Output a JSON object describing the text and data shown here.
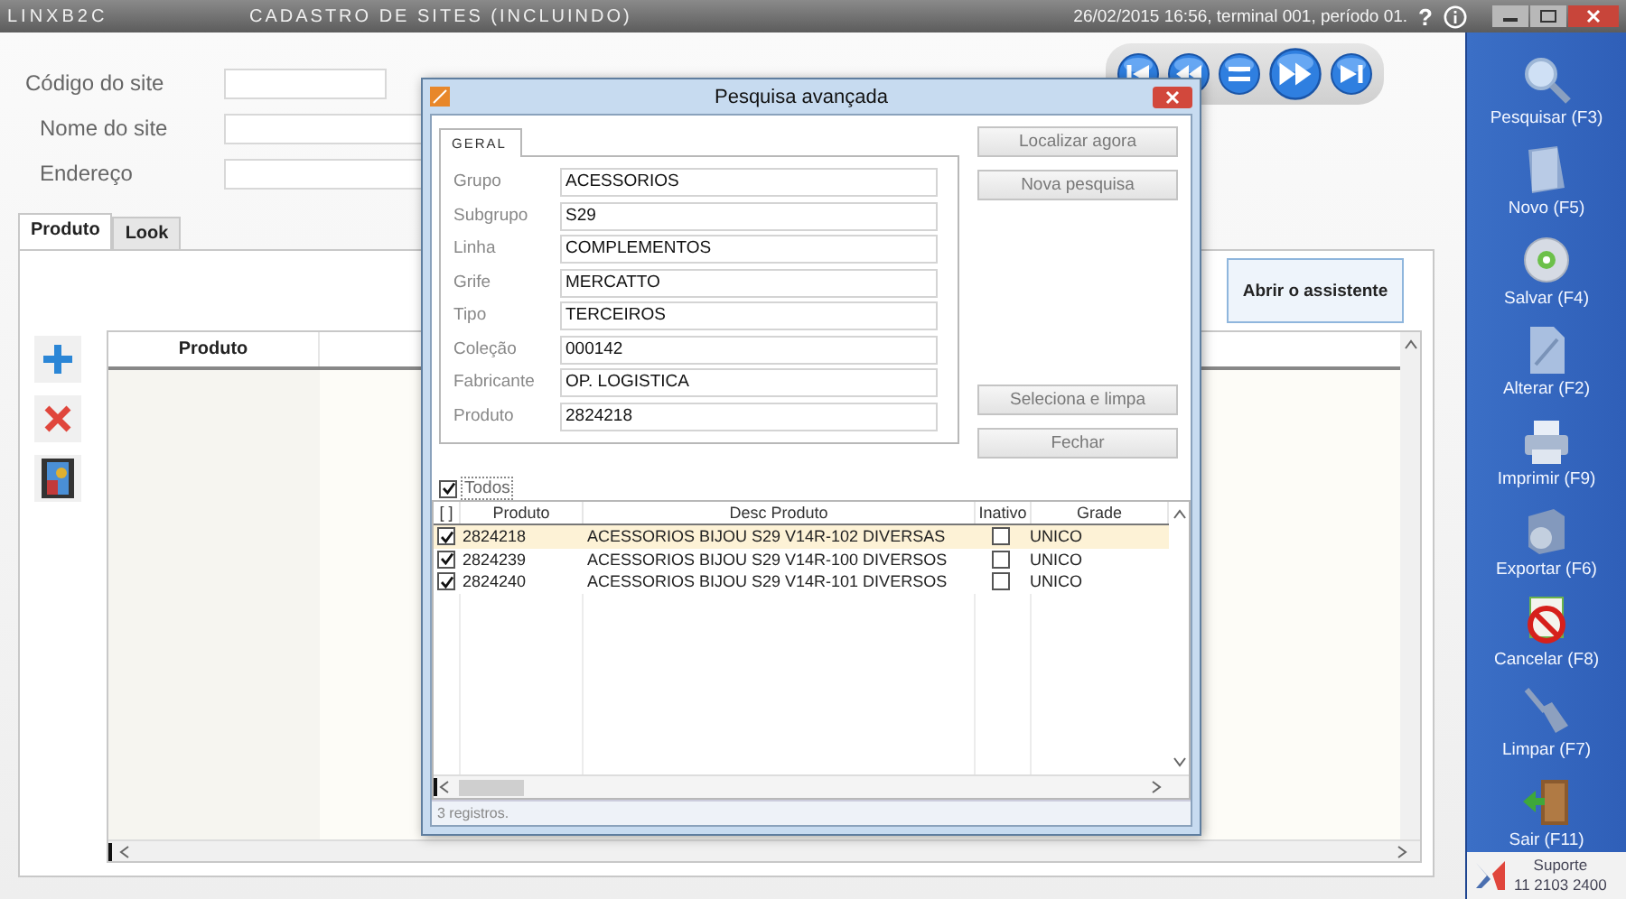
{
  "title_bar": {
    "brand": "LINXB2C",
    "title": "CADASTRO DE SITES (INCLUINDO)",
    "status": "26/02/2015 16:56, terminal 001, período 01.",
    "help": "?"
  },
  "form": {
    "fields": [
      {
        "label": "Código do site"
      },
      {
        "label": "Nome do site"
      },
      {
        "label": "Endereço"
      }
    ]
  },
  "tabs": [
    {
      "label": "Produto",
      "selected": true
    },
    {
      "label": "Look",
      "selected": false
    }
  ],
  "assistant_button": "Abrir o assistente",
  "grid": {
    "columns": [
      "Produto"
    ]
  },
  "dialog": {
    "title": "Pesquisa avançada",
    "tab": {
      "label": "GERAL",
      "selected": true
    },
    "fields": [
      {
        "label": "Grupo",
        "value": "ACESSORIOS"
      },
      {
        "label": "Subgrupo",
        "value": "S29"
      },
      {
        "label": "Linha",
        "value": "COMPLEMENTOS"
      },
      {
        "label": "Grife",
        "value": "MERCATTO"
      },
      {
        "label": "Tipo",
        "value": "TERCEIROS"
      },
      {
        "label": "Coleção",
        "value": "000142"
      },
      {
        "label": "Fabricante",
        "value": "OP. LOGISTICA"
      },
      {
        "label": "Produto",
        "value": "2824218"
      }
    ],
    "buttons": [
      "Localizar agora",
      "Nova pesquisa",
      "Seleciona e limpa",
      "Fechar"
    ],
    "select_all": {
      "label": "Todos",
      "checked": true
    },
    "table": {
      "columns": [
        "[ ]",
        "Produto",
        "Desc Produto",
        "Inativo",
        "Grade"
      ],
      "rows": [
        {
          "checked": true,
          "produto": "2824218",
          "desc": "ACESSORIOS BIJOU S29 V14R-102 DIVERSAS",
          "inactive": false,
          "grade": "UNICO",
          "selected": true
        },
        {
          "checked": true,
          "produto": "2824239",
          "desc": "ACESSORIOS BIJOU S29 V14R-100 DIVERSOS",
          "inactive": false,
          "grade": "UNICO",
          "selected": false
        },
        {
          "checked": true,
          "produto": "2824240",
          "desc": "ACESSORIOS BIJOU S29 V14R-101 DIVERSOS",
          "inactive": false,
          "grade": "UNICO",
          "selected": false
        }
      ]
    },
    "status": "3 registros."
  },
  "sidebar": {
    "items": [
      {
        "label": "Pesquisar (F3)"
      },
      {
        "label": "Novo (F5)"
      },
      {
        "label": "Salvar (F4)"
      },
      {
        "label": "Alterar (F2)"
      },
      {
        "label": "Imprimir (F9)"
      },
      {
        "label": "Exportar (F6)"
      },
      {
        "label": "Cancelar (F8)"
      },
      {
        "label": "Limpar (F7)"
      },
      {
        "label": "Sair (F11)"
      }
    ]
  },
  "support": {
    "label": "Suporte",
    "phone": "11 2103 2400"
  }
}
